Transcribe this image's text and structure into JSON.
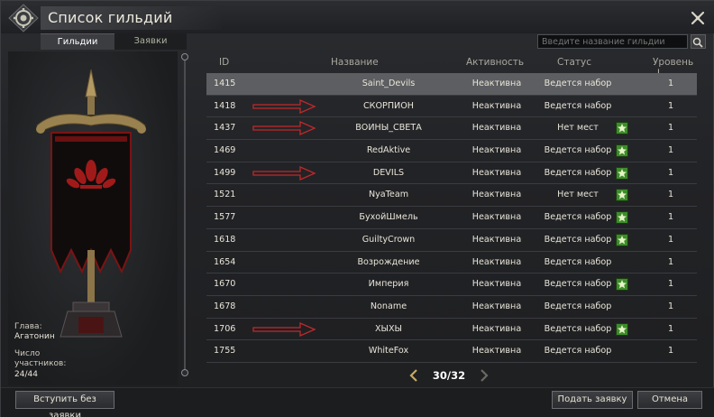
{
  "window": {
    "title": "Список гильдий"
  },
  "tabs": [
    {
      "label": "Гильдии",
      "active": true
    },
    {
      "label": "Заявки",
      "active": false
    }
  ],
  "search": {
    "placeholder": "Введите название гильдии",
    "icon": "search-icon"
  },
  "guild_info": {
    "leader_label": "Глава:",
    "leader_value": "Агатонин",
    "members_label": "Число участников:",
    "members_value": "24/44"
  },
  "table": {
    "headers": {
      "id": "ID",
      "name": "Название",
      "activity": "Активность",
      "status": "Статус",
      "level": "Уровень"
    },
    "sort_icon": "↓",
    "rows": [
      {
        "id": "1415",
        "name": "Saint_Devils",
        "activity": "Неактивна",
        "status": "Ведется набор",
        "star": false,
        "level": "1",
        "highlight": true,
        "arrow": false
      },
      {
        "id": "1418",
        "name": "СКОРПИОН",
        "activity": "Неактивна",
        "status": "Ведется набор",
        "star": false,
        "level": "1",
        "highlight": false,
        "arrow": true
      },
      {
        "id": "1437",
        "name": "ВОИНЫ_СВЕТА",
        "activity": "Неактивна",
        "status": "Нет мест",
        "star": true,
        "level": "1",
        "highlight": false,
        "arrow": true
      },
      {
        "id": "1469",
        "name": "RedAktive",
        "activity": "Неактивна",
        "status": "Ведется набор",
        "star": true,
        "level": "1",
        "highlight": false,
        "arrow": false
      },
      {
        "id": "1499",
        "name": "DEVILS",
        "activity": "Неактивна",
        "status": "Ведется набор",
        "star": true,
        "level": "1",
        "highlight": false,
        "arrow": true
      },
      {
        "id": "1521",
        "name": "NyaTeam",
        "activity": "Неактивна",
        "status": "Нет мест",
        "star": true,
        "level": "1",
        "highlight": false,
        "arrow": false
      },
      {
        "id": "1577",
        "name": "БухойШмель",
        "activity": "Неактивна",
        "status": "Ведется набор",
        "star": true,
        "level": "1",
        "highlight": false,
        "arrow": false
      },
      {
        "id": "1618",
        "name": "GuiltyCrown",
        "activity": "Неактивна",
        "status": "Ведется набор",
        "star": true,
        "level": "1",
        "highlight": false,
        "arrow": false
      },
      {
        "id": "1654",
        "name": "Возрождение",
        "activity": "Неактивна",
        "status": "Ведется набор",
        "star": false,
        "level": "1",
        "highlight": false,
        "arrow": false
      },
      {
        "id": "1670",
        "name": "Империя",
        "activity": "Неактивна",
        "status": "Ведется набор",
        "star": true,
        "level": "1",
        "highlight": false,
        "arrow": false
      },
      {
        "id": "1678",
        "name": "Noname",
        "activity": "Неактивна",
        "status": "Ведется набор",
        "star": false,
        "level": "1",
        "highlight": false,
        "arrow": false
      },
      {
        "id": "1706",
        "name": "ХЫХЫ",
        "activity": "Неактивна",
        "status": "Ведется набор",
        "star": true,
        "level": "1",
        "highlight": false,
        "arrow": true
      },
      {
        "id": "1755",
        "name": "WhiteFox",
        "activity": "Неактивна",
        "status": "Ведется набор",
        "star": false,
        "level": "1",
        "highlight": false,
        "arrow": false
      }
    ]
  },
  "pager": {
    "text": "30/32"
  },
  "buttons": {
    "join": "Вступить без заявки",
    "apply": "Подать заявку",
    "cancel": "Отмена"
  },
  "colors": {
    "star_green": "#3d8c2a",
    "arrow_red": "#c0282a",
    "highlight_row": "#5c5e61",
    "banner_red": "#8c1a1a"
  }
}
